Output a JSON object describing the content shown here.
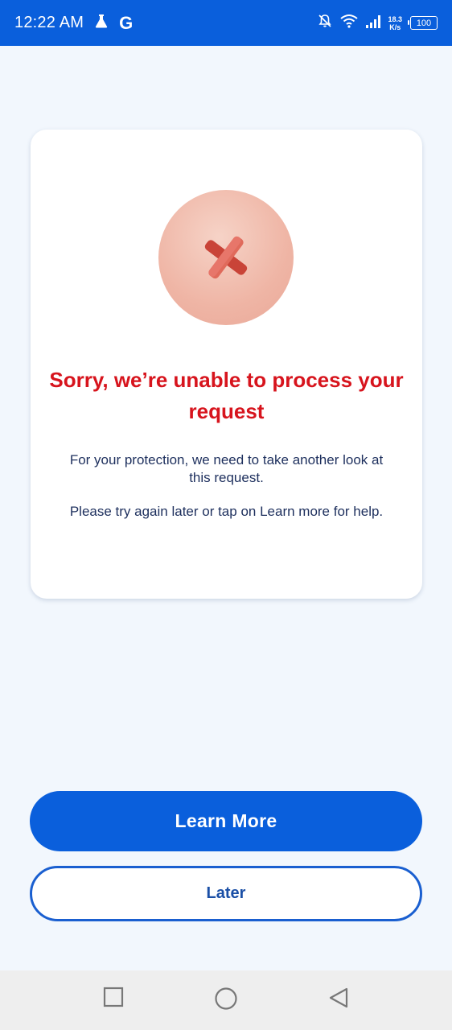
{
  "status_bar": {
    "time": "12:22 AM",
    "app_letter": "G",
    "speed_value": "18.3",
    "speed_unit": "K/s",
    "battery": "100",
    "icons": [
      "flask-icon",
      "google-icon",
      "bell-off-icon",
      "wifi-icon",
      "signal-icon",
      "battery-icon"
    ]
  },
  "dialog": {
    "icon": "error-x-icon",
    "title": "Sorry, we’re unable to process your request",
    "message_1": "For your protection, we need to take another look at this request.",
    "message_2": "Please try again later or tap on Learn more for help."
  },
  "actions": {
    "primary_label": "Learn More",
    "secondary_label": "Later"
  },
  "nav": {
    "icons": [
      "recents-square-icon",
      "home-circle-icon",
      "back-triangle-icon"
    ]
  },
  "colors": {
    "brand_blue": "#0a5fdc",
    "error_red": "#d7141d",
    "text_navy": "#1d2f5d",
    "background": "#f2f7fd"
  }
}
